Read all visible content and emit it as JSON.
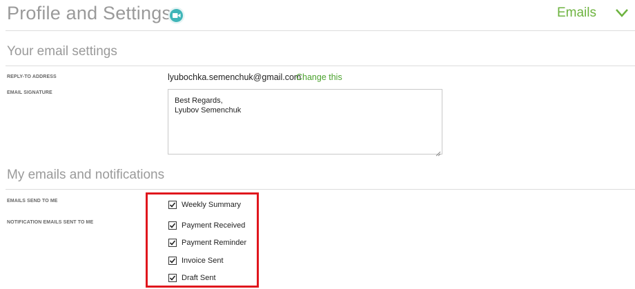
{
  "header": {
    "title": "Profile and Settings",
    "section_selected": "Emails",
    "video_icon": "video-camera-icon",
    "chevron_icon": "chevron-down-icon",
    "accent_color": "#6db33f"
  },
  "email_settings": {
    "heading": "Your email settings",
    "reply_to": {
      "label": "REPLY-TO ADDRESS",
      "value": "lyubochka.semenchuk@gmail.com",
      "change_link": "Change this"
    },
    "signature": {
      "label": "EMAIL SIGNATURE",
      "value": "Best Regards,\nLyubov Semenchuk"
    }
  },
  "notifications": {
    "heading": "My emails and notifications",
    "send_label": "EMAILS SEND TO ME",
    "notif_label": "NOTIFICATION EMAILS SENT TO ME",
    "items": [
      {
        "label": "Weekly Summary",
        "checked": true
      },
      {
        "label": "Payment Received",
        "checked": true
      },
      {
        "label": "Payment Reminder",
        "checked": true
      },
      {
        "label": "Invoice Sent",
        "checked": true
      },
      {
        "label": "Draft Sent",
        "checked": true
      }
    ],
    "highlight_color": "#e0161d"
  }
}
